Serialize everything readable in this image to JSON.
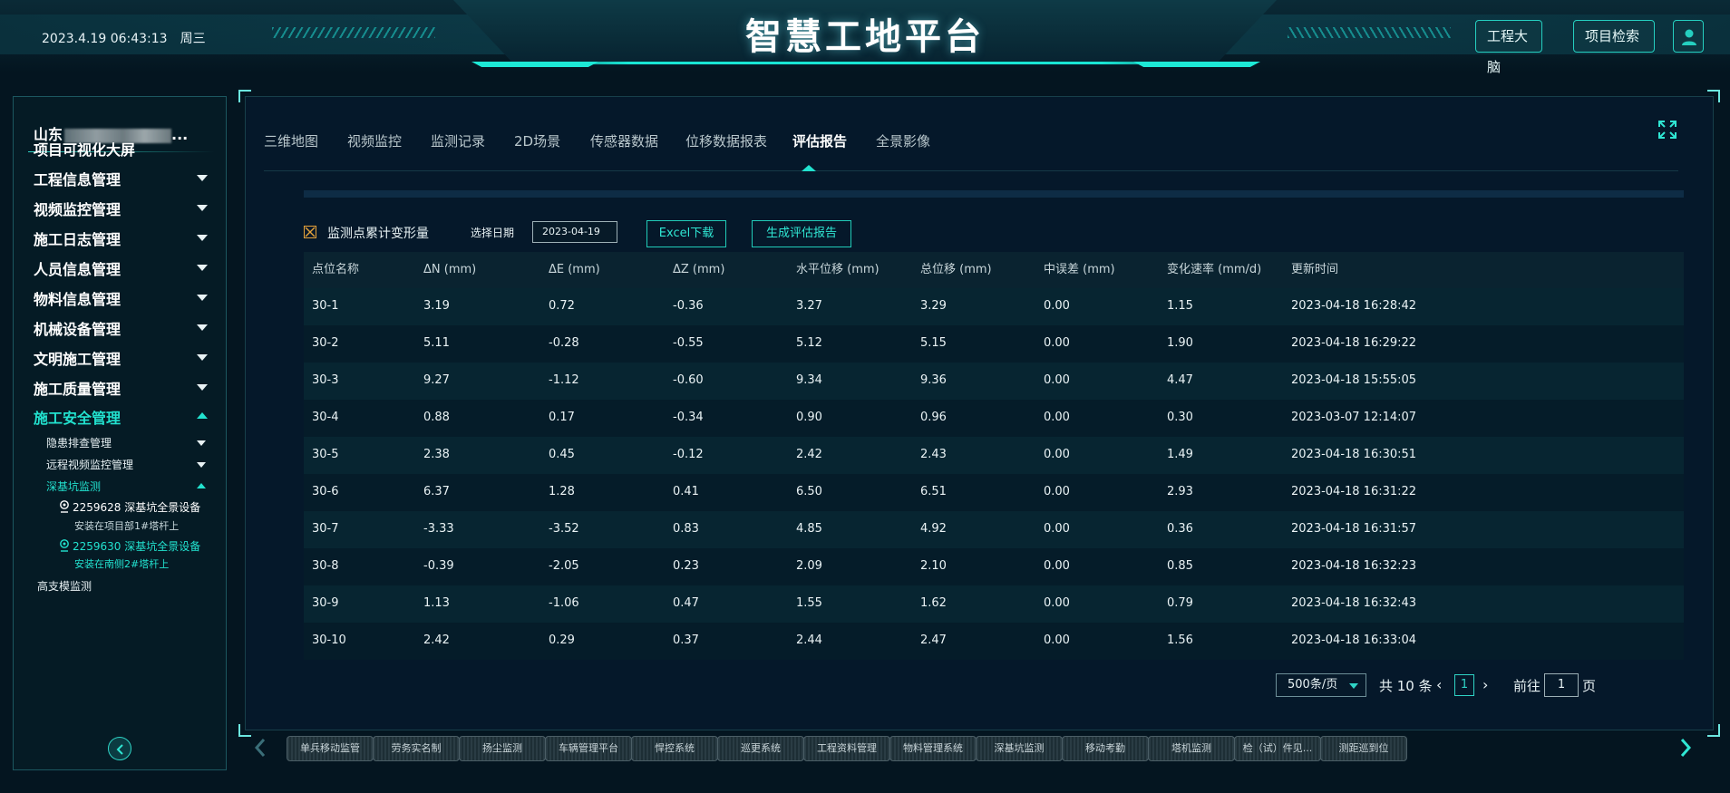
{
  "header": {
    "date": "2023.4.19 06:43:13",
    "weekday": "周三",
    "title": "智慧工地平台",
    "brain_button": "工程大脑",
    "search_button": "项目检索"
  },
  "sidebar": {
    "project_prefix": "山东",
    "project_suffix": "...",
    "menu": [
      {
        "label": "项目可视化大屏"
      },
      {
        "label": "工程信息管理"
      },
      {
        "label": "视频监控管理"
      },
      {
        "label": "施工日志管理"
      },
      {
        "label": "人员信息管理"
      },
      {
        "label": "物料信息管理"
      },
      {
        "label": "机械设备管理"
      },
      {
        "label": "文明施工管理"
      },
      {
        "label": "施工质量管理"
      },
      {
        "label": "施工安全管理"
      }
    ],
    "submenu": [
      {
        "label": "隐患排查管理"
      },
      {
        "label": "远程视频监控管理"
      },
      {
        "label": "深基坑监测"
      }
    ],
    "devices": [
      {
        "name": "2259628  深基坑全景设备",
        "location": "安装在项目部1#塔杆上"
      },
      {
        "name": "2259630  深基坑全景设备",
        "location": "安装在南侧2#塔杆上"
      }
    ],
    "last_item": "高支模监测"
  },
  "tabs": [
    {
      "label": "三维地图"
    },
    {
      "label": "视频监控"
    },
    {
      "label": "监测记录"
    },
    {
      "label": "2D场景"
    },
    {
      "label": "传感器数据"
    },
    {
      "label": "位移数据报表"
    },
    {
      "label": "评估报告"
    },
    {
      "label": "全景影像"
    }
  ],
  "toolbar": {
    "checkbox_label": "监测点累计变形量",
    "date_label": "选择日期",
    "date_value": "2023-04-19",
    "excel_button": "Excel下载",
    "report_button": "生成评估报告"
  },
  "table": {
    "headers": [
      "点位名称",
      "ΔN (mm)",
      "ΔE (mm)",
      "ΔZ (mm)",
      "水平位移 (mm)",
      "总位移 (mm)",
      "中误差 (mm)",
      "变化速率 (mm/d)",
      "更新时间"
    ],
    "rows": [
      [
        "30-1",
        "3.19",
        "0.72",
        "-0.36",
        "3.27",
        "3.29",
        "0.00",
        "1.15",
        "2023-04-18 16:28:42"
      ],
      [
        "30-2",
        "5.11",
        "-0.28",
        "-0.55",
        "5.12",
        "5.15",
        "0.00",
        "1.90",
        "2023-04-18 16:29:22"
      ],
      [
        "30-3",
        "9.27",
        "-1.12",
        "-0.60",
        "9.34",
        "9.36",
        "0.00",
        "4.47",
        "2023-04-18 15:55:05"
      ],
      [
        "30-4",
        "0.88",
        "0.17",
        "-0.34",
        "0.90",
        "0.96",
        "0.00",
        "0.30",
        "2023-03-07 12:14:07"
      ],
      [
        "30-5",
        "2.38",
        "0.45",
        "-0.12",
        "2.42",
        "2.43",
        "0.00",
        "1.49",
        "2023-04-18 16:30:51"
      ],
      [
        "30-6",
        "6.37",
        "1.28",
        "0.41",
        "6.50",
        "6.51",
        "0.00",
        "2.93",
        "2023-04-18 16:31:22"
      ],
      [
        "30-7",
        "-3.33",
        "-3.52",
        "0.83",
        "4.85",
        "4.92",
        "0.00",
        "0.36",
        "2023-04-18 16:31:57"
      ],
      [
        "30-8",
        "-0.39",
        "-2.05",
        "0.23",
        "2.09",
        "2.10",
        "0.00",
        "0.85",
        "2023-04-18 16:32:23"
      ],
      [
        "30-9",
        "1.13",
        "-1.06",
        "0.47",
        "1.55",
        "1.62",
        "0.00",
        "0.79",
        "2023-04-18 16:32:43"
      ],
      [
        "30-10",
        "2.42",
        "0.29",
        "0.37",
        "2.44",
        "2.47",
        "0.00",
        "1.56",
        "2023-04-18 16:33:04"
      ]
    ]
  },
  "pager": {
    "page_size": "500条/页",
    "total": "共 10 条",
    "prev": "‹",
    "current": "1",
    "next": "›",
    "goto_label": "前往",
    "goto_value": "1",
    "page_suffix": "页"
  },
  "bottom_bar": [
    {
      "label": "单兵移动监管"
    },
    {
      "label": "劳务实名制"
    },
    {
      "label": "扬尘监测"
    },
    {
      "label": "车辆管理平台"
    },
    {
      "label": "悍控系统"
    },
    {
      "label": "巡更系统"
    },
    {
      "label": "工程资料管理"
    },
    {
      "label": "物料管理系统"
    },
    {
      "label": "深基坑监测"
    },
    {
      "label": "移动考勤"
    },
    {
      "label": "塔机监测"
    },
    {
      "label": "检（试）件见..."
    },
    {
      "label": "测距巡到位"
    }
  ],
  "colors": {
    "accent": "#22e2cf",
    "background": "#041520",
    "checkbox": "#e7a33b"
  }
}
